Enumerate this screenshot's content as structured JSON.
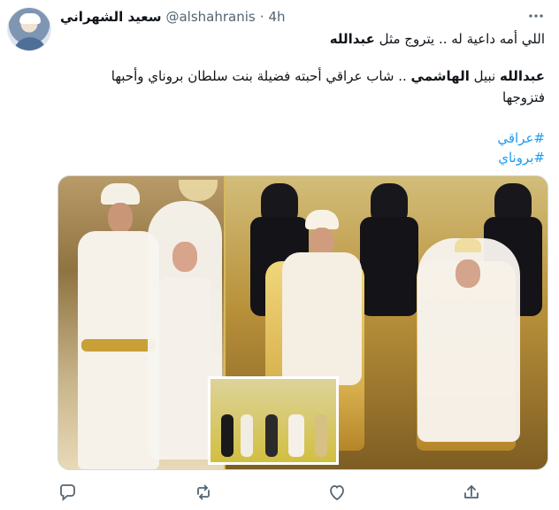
{
  "tweet": {
    "display_name": "سعيد الشهراني",
    "handle": "@alshahranis",
    "separator": "·",
    "time": "4h",
    "text_line_1_prefix": "اللي أمه داعية له .. يتروج مثل ",
    "text_line_1_bold": "عبدالله",
    "text_line_2_bold_1": "عبدالله",
    "text_line_2_mid": " نبيل ",
    "text_line_2_bold_2": "الهاشمي",
    "text_line_2_suffix": " .. شاب عراقي أحبته فضيلة بنت سلطان بروناي وأحبها",
    "text_line_3": "فتزوجها",
    "hashtags": [
      "#عراقي",
      "#بروناي"
    ]
  },
  "icons": {
    "more": "more-icon",
    "reply": "reply-icon",
    "retweet": "retweet-icon",
    "like": "heart-icon",
    "share": "share-icon"
  },
  "colors": {
    "link": "#1d9bf0",
    "secondary_text": "#536471",
    "primary_text": "#0f1419"
  }
}
